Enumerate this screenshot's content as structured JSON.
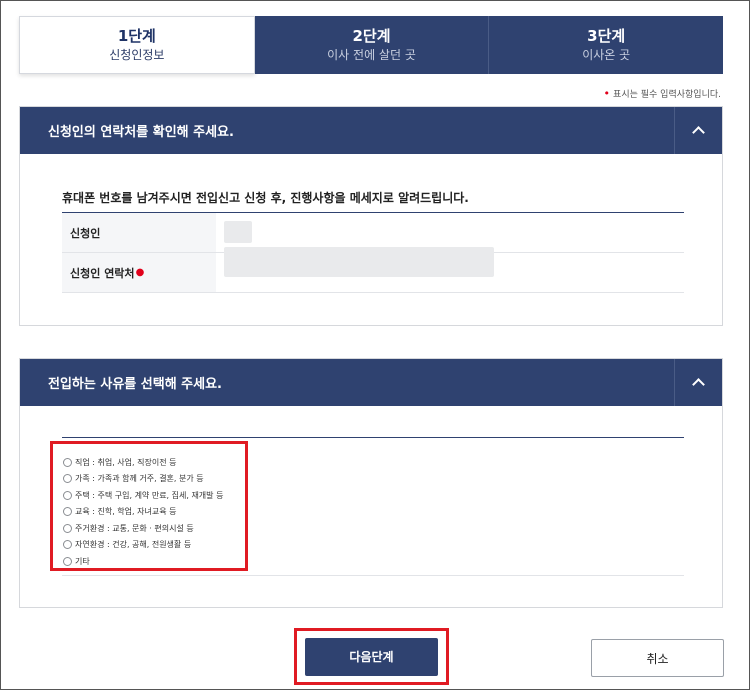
{
  "steps": [
    {
      "num": "1단계",
      "name": "신청인정보",
      "active": true
    },
    {
      "num": "2단계",
      "name": "이사 전에 살던 곳",
      "active": false
    },
    {
      "num": "3단계",
      "name": "이사온 곳",
      "active": false
    }
  ],
  "required_note": "표시는 필수 입력사항입니다.",
  "contact_section": {
    "title": "신청인의 연락처를 확인해 주세요.",
    "notice": "휴대폰 번호를 남겨주시면 전입신고 신청 후, 진행사항을 메세지로 알려드립니다.",
    "applicant_label": "신청인",
    "phone_label": "신청인 연락처"
  },
  "reason_section": {
    "title": "전입하는 사유를 선택해 주세요.",
    "options": [
      "직업 : 취업, 사업, 직장이전 등",
      "가족 : 가족과 함께 거주, 결혼, 분가 등",
      "주택 : 주택 구입, 계약 만료, 집세, 재개발 등",
      "교육 : 진학, 학업, 자녀교육 등",
      "주거환경 : 교통, 문화 · 편의시설 등",
      "자연환경 : 건강, 공해, 전원생활 등",
      "기타"
    ]
  },
  "buttons": {
    "next": "다음단계",
    "cancel": "취소"
  },
  "colors": {
    "primary": "#2f4270",
    "highlight": "#e01b23",
    "required": "#e1001b"
  }
}
